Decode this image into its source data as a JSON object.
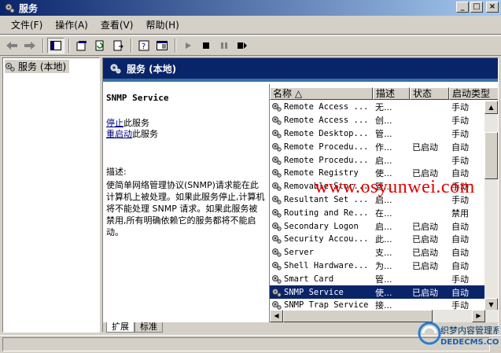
{
  "window": {
    "title": "服务",
    "buttons": {
      "minimize": "_",
      "maximize": "□",
      "close": "×"
    }
  },
  "menu": [
    "文件(F)",
    "操作(A)",
    "查看(V)",
    "帮助(H)"
  ],
  "tree": {
    "item": "服务 (本地)"
  },
  "pane": {
    "header": "服务 (本地)"
  },
  "detail": {
    "service_name": "SNMP Service",
    "stop_link": "停止",
    "stop_suffix": "此服务",
    "restart_link": "重启动",
    "restart_suffix": "此服务",
    "desc_label": "描述:",
    "desc_text": "使简单网络管理协议(SNMP)请求能在此计算机上被处理。如果此服务停止,计算机将不能处理 SNMP 请求。如果此服务被禁用,所有明确依赖它的服务都将不能启动。"
  },
  "columns": [
    "名称 △",
    "描述",
    "状态",
    "启动类型"
  ],
  "rows": [
    {
      "name": "Remote Access ...",
      "desc": "无...",
      "status": "",
      "type": "手动"
    },
    {
      "name": "Remote Access ...",
      "desc": "创...",
      "status": "",
      "type": "手动"
    },
    {
      "name": "Remote Desktop...",
      "desc": "管...",
      "status": "",
      "type": "手动"
    },
    {
      "name": "Remote Procedu...",
      "desc": "作...",
      "status": "已启动",
      "type": "自动"
    },
    {
      "name": "Remote Procedu...",
      "desc": "启...",
      "status": "",
      "type": "手动"
    },
    {
      "name": "Remote Registry",
      "desc": "使...",
      "status": "已启动",
      "type": "自动"
    },
    {
      "name": "Removable Stor...",
      "desc": "管...",
      "status": "",
      "type": "手动"
    },
    {
      "name": "Resultant Set ...",
      "desc": "启...",
      "status": "",
      "type": "手动"
    },
    {
      "name": "Routing and Re...",
      "desc": "在...",
      "status": "",
      "type": "禁用"
    },
    {
      "name": "Secondary Logon",
      "desc": "启...",
      "status": "已启动",
      "type": "自动"
    },
    {
      "name": "Security Accou...",
      "desc": "此...",
      "status": "已启动",
      "type": "自动"
    },
    {
      "name": "Server",
      "desc": "支...",
      "status": "已启动",
      "type": "自动"
    },
    {
      "name": "Shell Hardware...",
      "desc": "为...",
      "status": "已启动",
      "type": "自动"
    },
    {
      "name": "Smart Card",
      "desc": "管...",
      "status": "",
      "type": "手动"
    },
    {
      "name": "SNMP Service",
      "desc": "使...",
      "status": "已启动",
      "type": "自动"
    },
    {
      "name": "SNMP Trap Service",
      "desc": "接...",
      "status": "",
      "type": "手动"
    }
  ],
  "selected_row": 14,
  "tabs": [
    "扩展",
    "标准"
  ],
  "watermark": "www.osyunwei.com",
  "logo": {
    "line1": "织梦内容管理系统",
    "line2": "DEDECMS.COM"
  },
  "colors": {
    "title_gradient_start": "#0a246a",
    "selection": "#0a246a",
    "watermark": "#e00000"
  }
}
